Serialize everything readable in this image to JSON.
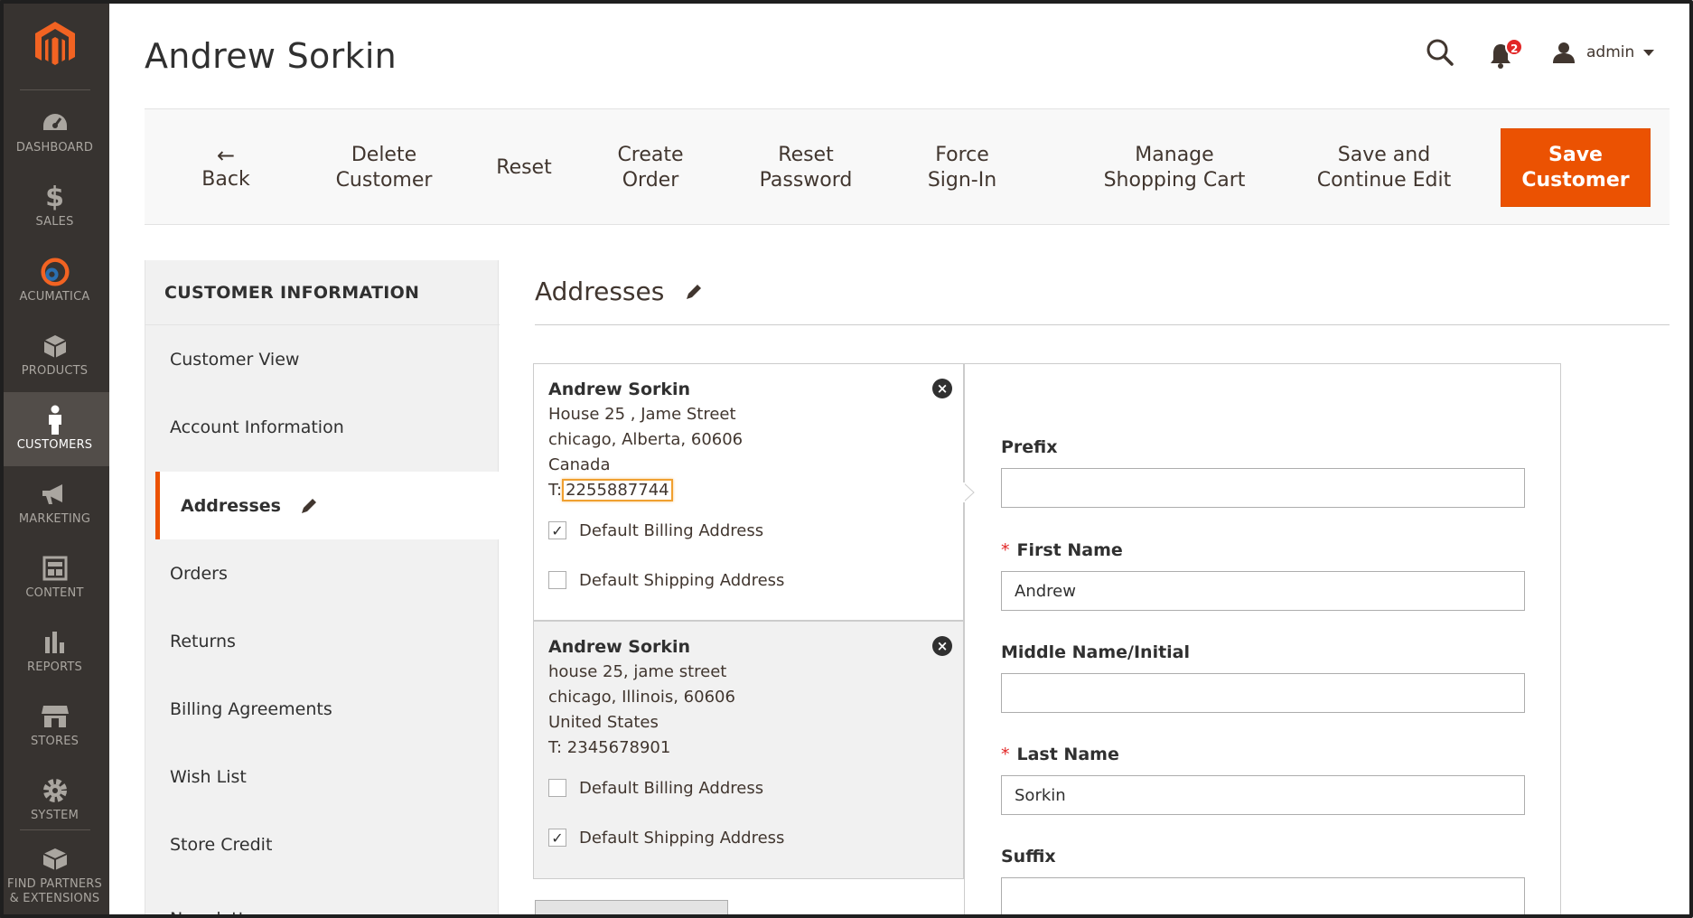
{
  "sidebar": {
    "logo_name": "magento-logo",
    "items": [
      {
        "label": "DASHBOARD",
        "icon": "dashboard-icon",
        "active": false
      },
      {
        "label": "SALES",
        "icon": "dollar-icon",
        "active": false
      },
      {
        "label": "ACUMATICA",
        "icon": "acumatica-icon",
        "active": false
      },
      {
        "label": "PRODUCTS",
        "icon": "box-icon",
        "active": false
      },
      {
        "label": "CUSTOMERS",
        "icon": "person-icon",
        "active": true
      },
      {
        "label": "MARKETING",
        "icon": "megaphone-icon",
        "active": false
      },
      {
        "label": "CONTENT",
        "icon": "content-icon",
        "active": false
      },
      {
        "label": "REPORTS",
        "icon": "bar-chart-icon",
        "active": false
      },
      {
        "label": "STORES",
        "icon": "store-icon",
        "active": false
      },
      {
        "label": "SYSTEM",
        "icon": "gear-icon",
        "active": false
      },
      {
        "label": "FIND PARTNERS & EXTENSIONS",
        "icon": "partners-icon",
        "active": false
      }
    ]
  },
  "header": {
    "title": "Andrew Sorkin",
    "notifications_count": "2",
    "user_name": "admin"
  },
  "toolbar": {
    "back_arrow": "←",
    "back_label": "Back",
    "delete_line1": "Delete",
    "delete_line2": "Customer",
    "reset_label": "Reset",
    "create_line1": "Create",
    "create_line2": "Order",
    "reset_pw_line1": "Reset",
    "reset_pw_line2": "Password",
    "force_line1": "Force",
    "force_line2": "Sign-In",
    "cart_line1": "Manage",
    "cart_line2": "Shopping Cart",
    "save_continue_line1": "Save and",
    "save_continue_line2": "Continue Edit",
    "save_line1": "Save",
    "save_line2": "Customer",
    "accent_color": "#eb5202"
  },
  "tabs": {
    "title": "CUSTOMER INFORMATION",
    "items": [
      {
        "label": "Customer View"
      },
      {
        "label": "Account Information"
      },
      {
        "label": "Addresses"
      },
      {
        "label": "Orders"
      },
      {
        "label": "Returns"
      },
      {
        "label": "Billing Agreements"
      },
      {
        "label": "Wish List"
      },
      {
        "label": "Store Credit"
      },
      {
        "label": "Newsletter"
      }
    ]
  },
  "section": {
    "title": "Addresses"
  },
  "addresses": [
    {
      "name": "Andrew Sorkin",
      "street": "House 25 , Jame Street",
      "city_line": "chicago, Alberta, 60606",
      "country": "Canada",
      "tel_prefix": "T:",
      "tel": "2255887744",
      "billing_label": "Default Billing Address",
      "billing_checked": true,
      "shipping_label": "Default Shipping Address",
      "shipping_checked": false
    },
    {
      "name": "Andrew Sorkin",
      "street": "house 25, jame street",
      "city_line": "chicago, Illinois, 60606",
      "country": "United States",
      "tel_line": "T: 2345678901",
      "billing_label": "Default Billing Address",
      "billing_checked": false,
      "shipping_label": "Default Shipping Address",
      "shipping_checked": true
    }
  ],
  "form": {
    "prefix_label": "Prefix",
    "prefix_value": "",
    "first_name_label": "First Name",
    "first_name_value": "Andrew",
    "middle_label": "Middle Name/Initial",
    "middle_value": "",
    "last_name_label": "Last Name",
    "last_name_value": "Sorkin",
    "suffix_label": "Suffix",
    "suffix_value": "",
    "required_mark": "*"
  }
}
